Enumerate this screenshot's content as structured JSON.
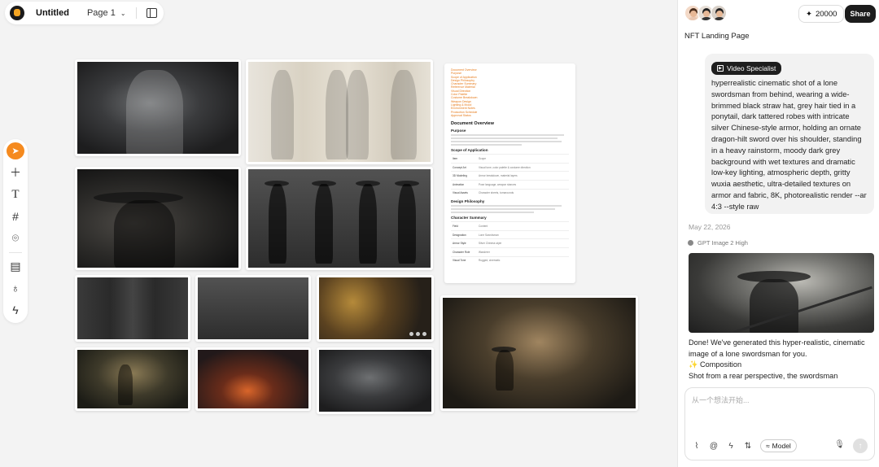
{
  "header": {
    "title": "Untitled",
    "page_label": "Page 1"
  },
  "toolbar": {
    "icons": [
      "pointer-icon",
      "plus-icon",
      "text-icon",
      "frame-icon",
      "pin-icon",
      "layout-icon",
      "bulb-icon",
      "bolt-icon"
    ]
  },
  "document_card": {
    "links": [
      "Document Overview",
      "Purpose",
      "Scope of Application",
      "Design Philosophy",
      "Character Summary",
      "Reference Material",
      "Visual Direction",
      "Color Palette",
      "Costume Breakdown",
      "Weapon Design",
      "Lighting & Mood",
      "Environment Notes",
      "Production Schedule",
      "Approval Status"
    ],
    "overview_heading": "Document Overview",
    "purpose_heading": "Purpose",
    "scope_heading": "Scope of Application",
    "design_heading": "Design Philosophy",
    "summary_heading": "Character Summary",
    "scope_rows": [
      [
        "Item",
        "Scope"
      ],
      [
        "Concept Art",
        "Visual tone, color palette & costume direction"
      ],
      [
        "3D Modeling",
        "Armor breakdown, material layers"
      ],
      [
        "Animation",
        "Pose language, weapon stances"
      ],
      [
        "Visual Assets",
        "Character sheets, turnarounds"
      ]
    ],
    "summary_rows": [
      [
        "Field",
        "Content"
      ],
      [
        "Designation",
        "Lone Swordsman"
      ],
      [
        "Armor Style",
        "Silver Chinese-style"
      ],
      [
        "Character Role",
        "Wanderer"
      ],
      [
        "Visual Tone",
        "Rugged, cinematic"
      ]
    ]
  },
  "sidebar": {
    "credits": "20000",
    "share_label": "Share",
    "project_title": "NFT Landing Page",
    "chip_label": "Video Specialist",
    "prompt": "hyperrealistic cinematic shot of a lone swordsman from behind, wearing a wide-brimmed black straw hat, grey hair tied in a ponytail, dark tattered robes with intricate silver Chinese-style armor, holding an ornate dragon-hilt sword over his shoulder, standing in a heavy rainstorm, moody dark grey background with wet textures and dramatic low-key lighting, atmospheric depth, gritty wuxia aesthetic, ultra-detailed textures on armor and fabric, 8K, photorealistic render --ar 4:3 --style raw",
    "date": "May 22, 2026",
    "model_name": "GPT Image 2 High",
    "answer_line1": "Done! We've generated this hyper-realistic, cinematic image of a lone swordsman for you.",
    "composition_label": "✨ Composition",
    "answer_line2": "Shot from a rear perspective, the swordsman",
    "input_placeholder": "从一个想法开始...",
    "model_button": "Model"
  }
}
